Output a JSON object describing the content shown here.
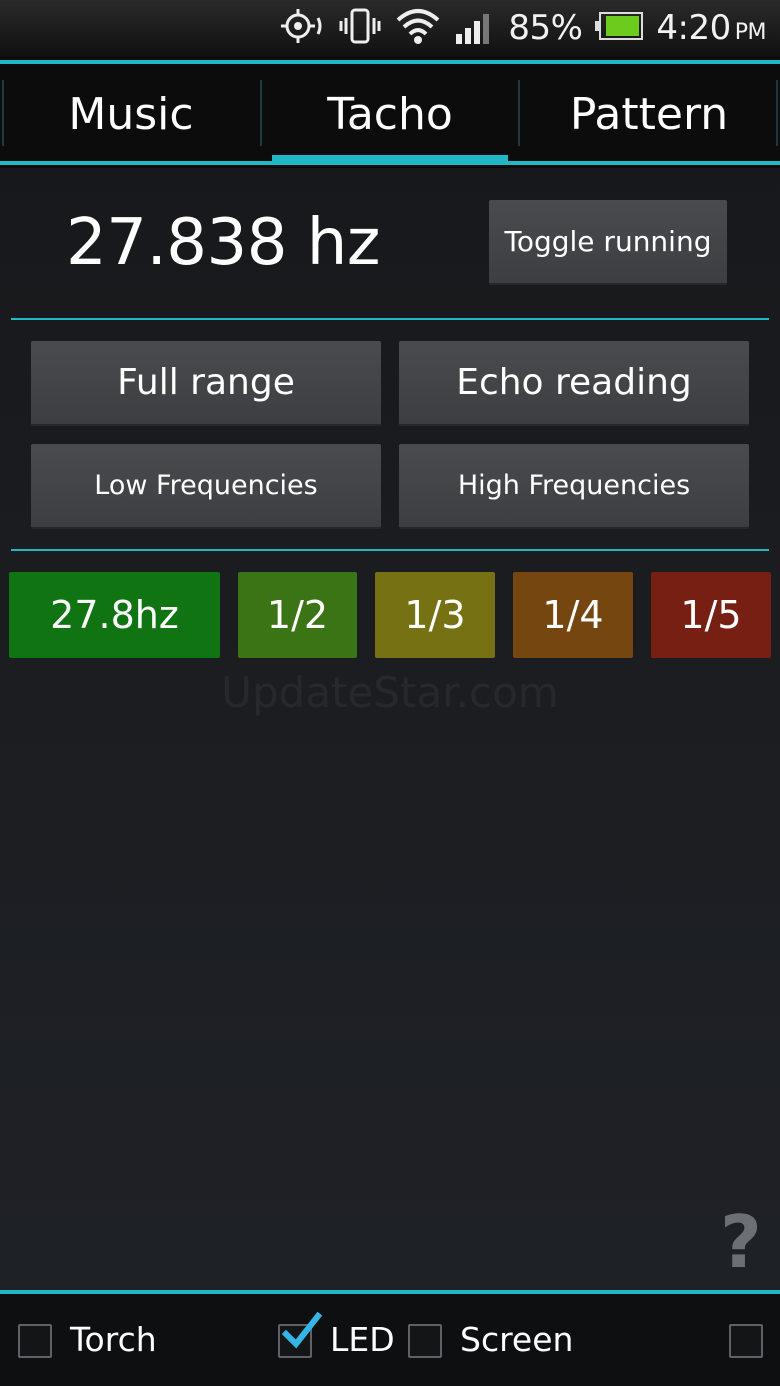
{
  "status_bar": {
    "icons": [
      "gps-icon",
      "vibrate-icon",
      "wifi-icon",
      "signal-icon",
      "battery-icon"
    ],
    "battery_percent": "85%",
    "time": "4:20",
    "ampm": "PM",
    "battery_color": "#6dcb1e"
  },
  "tabs": [
    {
      "label": "Music"
    },
    {
      "label": "Tacho"
    },
    {
      "label": "Pattern"
    }
  ],
  "active_tab": "Tacho",
  "accent_color": "#1fb8c4",
  "readout": {
    "frequency": "27.838 hz",
    "toggle_label": "Toggle running"
  },
  "modes": {
    "full_range": "Full range",
    "echo_reading": "Echo reading",
    "low_frequencies": "Low Frequencies",
    "high_frequencies": "High Frequencies"
  },
  "harmonics": [
    {
      "label": "27.8hz",
      "color": "#0f7411"
    },
    {
      "label": "1/2",
      "color": "#3a7414"
    },
    {
      "label": "1/3",
      "color": "#767113"
    },
    {
      "label": "1/4",
      "color": "#764611"
    },
    {
      "label": "1/5",
      "color": "#761f12"
    }
  ],
  "watermark": "UpdateStar.com",
  "help_label": "?",
  "bottom_options": [
    {
      "label": "Torch",
      "checked": false
    },
    {
      "label": "LED",
      "checked": true
    },
    {
      "label": "Screen",
      "checked": false
    },
    {
      "label": "",
      "checked": false
    }
  ]
}
